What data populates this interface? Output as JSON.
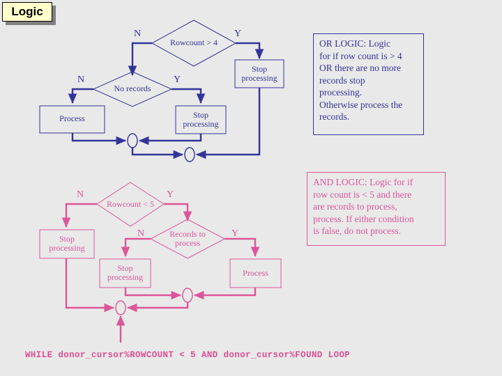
{
  "slide": {
    "title": "Logic",
    "background_color": "#e9e9e9",
    "or_color": "#333399",
    "and_color": "#dd5599"
  },
  "or_flow": {
    "color": "#333399",
    "nodes": {
      "rowcount_decision": "Rowcount > 4",
      "no_records_decision": "No records",
      "process_box": "Process",
      "stop_box_left": "Stop\nprocessing",
      "stop_box_right": "Stop\nprocessing"
    },
    "branches": {
      "rowcount_no": "N",
      "rowcount_yes": "Y",
      "no_records_no": "N",
      "no_records_yes": "Y"
    }
  },
  "and_flow": {
    "color": "#dd5599",
    "nodes": {
      "rowcount_decision": "Rowcount < 5",
      "records_decision": "Records to\nprocess",
      "stop_box_left": "Stop\nprocessing",
      "stop_box_mid": "Stop\nprocessing",
      "process_box": "Process"
    },
    "branches": {
      "rowcount_no": "N",
      "rowcount_yes": "Y",
      "records_no": "N",
      "records_yes": "Y"
    }
  },
  "notes": {
    "or_note": "OR LOGIC: Logic\nfor if row count is > 4\nOR there are no more\nrecords stop\nprocessing.\nOtherwise process the\nrecords.",
    "and_note": "AND LOGIC: Logic for if\nrow count is < 5 and there\nare records to process,\nprocess.  If either condition\nis false, do not process."
  },
  "code": {
    "line": "WHILE donor_cursor%ROWCOUNT < 5 AND donor_cursor%FOUND LOOP"
  }
}
